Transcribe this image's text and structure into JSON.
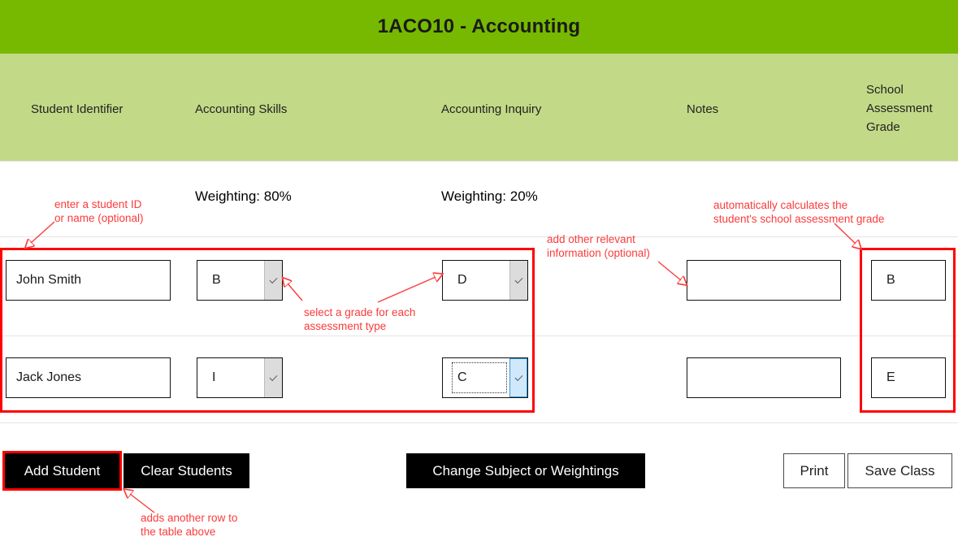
{
  "header": {
    "title": "1ACO10 - Accounting"
  },
  "columns": [
    {
      "label": "Student Identifier"
    },
    {
      "label": "Accounting Skills"
    },
    {
      "label": "Accounting Inquiry"
    },
    {
      "label": "Notes"
    },
    {
      "label": "School\nAssessment\nGrade"
    }
  ],
  "weightings": {
    "skills": "Weighting: 80%",
    "inquiry": "Weighting: 20%"
  },
  "rows": [
    {
      "student": "John Smith",
      "skills_grade": "B",
      "inquiry_grade": "D",
      "notes": "",
      "school_assessment_grade": "B",
      "inquiry_focused": false
    },
    {
      "student": "Jack Jones",
      "skills_grade": "I",
      "inquiry_grade": "C",
      "notes": "",
      "school_assessment_grade": "E",
      "inquiry_focused": true
    }
  ],
  "placeholders": {
    "student": "",
    "notes": ""
  },
  "buttons": {
    "add_student": "Add Student",
    "clear_students": "Clear Students",
    "change_subject": "Change Subject or Weightings",
    "print": "Print",
    "save_class": "Save Class"
  },
  "annotations": {
    "student_id": "enter a student ID\nor name (optional)",
    "select_grade": "select a grade for each\nassessment type",
    "notes": "add other relevant\ninformation (optional)",
    "school_grade": "automatically calculates the\nstudent's school assessment grade",
    "add_student": "adds another row to\nthe table above"
  },
  "colors": {
    "title_band": "#76b900",
    "header_band": "#c2da87",
    "annotation": "#ff0000",
    "button_dark": "#000000",
    "focus_blue": "#cfe8fb"
  }
}
